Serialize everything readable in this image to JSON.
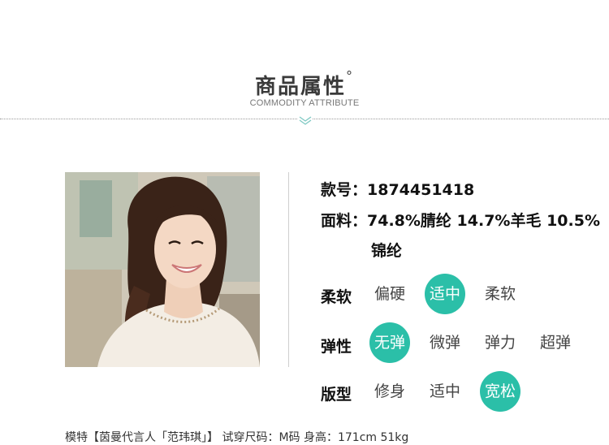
{
  "header": {
    "title": "商品属性",
    "degree": "°",
    "subtitle": "COMMODITY ATTRIBUTE"
  },
  "product": {
    "style_no_label": "款号：",
    "style_no": "1874451418",
    "fabric_label": "面料：",
    "fabric_line1": "74.8%腈纶 14.7%羊毛 10.5%",
    "fabric_line2": "锦纶"
  },
  "attributes": {
    "softness": {
      "label": "柔软",
      "options": [
        "偏硬",
        "适中",
        "柔软"
      ],
      "selected": "适中"
    },
    "elasticity": {
      "label": "弹性",
      "options": [
        "无弹",
        "微弹",
        "弹力",
        "超弹"
      ],
      "selected": "无弹"
    },
    "fit": {
      "label": "版型",
      "options": [
        "修身",
        "适中",
        "宽松"
      ],
      "selected": "宽松"
    }
  },
  "caption": "模特【茵曼代言人「范玮琪」】 试穿尺码：M码  身高：171cm 51kg",
  "colors": {
    "accent": "#2bbfa8",
    "divider": "#cfcfcf"
  }
}
